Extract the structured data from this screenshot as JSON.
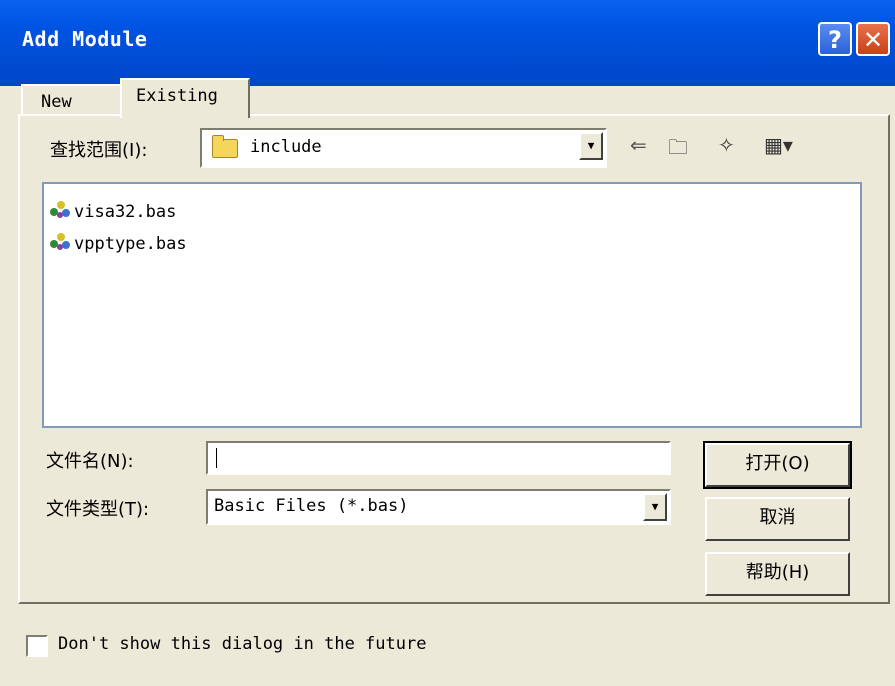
{
  "window": {
    "title": "Add Module",
    "help_glyph": "?",
    "close_glyph": "✕"
  },
  "tabs": [
    {
      "label": "New"
    },
    {
      "label": "Existing"
    }
  ],
  "lookin": {
    "label": "查找范围(I):",
    "value": "include"
  },
  "toolbar": {
    "back_glyph": "⇐",
    "up_glyph": "🗀",
    "newfolder_glyph": "✧",
    "view_glyph": "▦▾"
  },
  "files": [
    {
      "name": "visa32.bas"
    },
    {
      "name": "vpptype.bas"
    }
  ],
  "filename": {
    "label": "文件名(N):",
    "value": ""
  },
  "filetype": {
    "label": "文件类型(T):",
    "value": "Basic Files (*.bas)"
  },
  "buttons": {
    "open": "打开(O)",
    "cancel": "取消",
    "help": "帮助(H)"
  },
  "dont_show": {
    "label": "Don't show this dialog in the future"
  },
  "colors": {
    "titlebar": "#0054e3",
    "dialog_bg": "#ece9d8",
    "listbox_border": "#7f9db9"
  }
}
